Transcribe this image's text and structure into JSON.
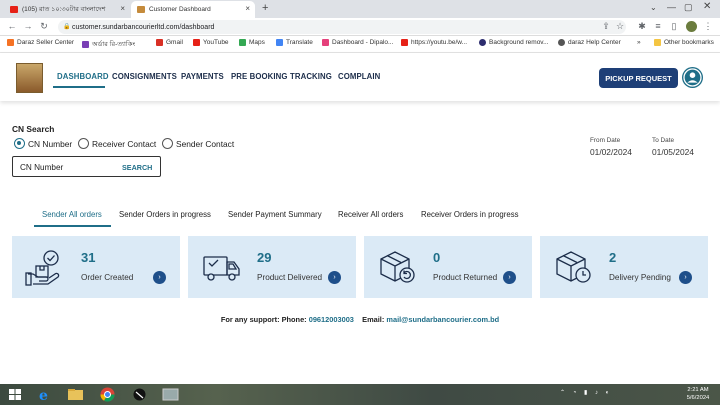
{
  "browser": {
    "tabs": [
      {
        "label": "(105) রাত ১০:৩০টার বাংলাদেশ",
        "active": false
      },
      {
        "label": "Customer Dashboard",
        "active": true
      }
    ],
    "url": "customer.sundarbancourierltd.com/dashboard",
    "bookmarks": [
      "Daraz Seller Center",
      "অর্ডার রি-ত্যাকিং",
      "Gmail",
      "YouTube",
      "Maps",
      "Translate",
      "Dashboard - Dipalo...",
      "https://youtu.be/w...",
      "Background remov...",
      "daraz Help Center",
      "Other bookmarks"
    ]
  },
  "nav": {
    "items": [
      "DASHBOARD",
      "CONSIGNMENTS",
      "PAYMENTS",
      "PRE BOOKING",
      "TRACKING",
      "COMPLAIN"
    ],
    "active": 0,
    "pickup_label": "PICKUP REQUEST"
  },
  "search": {
    "title": "CN Search",
    "options": [
      "CN Number",
      "Receiver Contact",
      "Sender Contact"
    ],
    "selected": 0,
    "input_value": "CN Number",
    "button_label": "SEARCH"
  },
  "dates": {
    "from_label": "From Date",
    "from_value": "01/02/2024",
    "to_label": "To Date",
    "to_value": "01/05/2024"
  },
  "order_tabs": [
    "Sender All orders",
    "Sender Orders in progress",
    "Sender Payment Summary",
    "Receiver All orders",
    "Receiver Orders in progress"
  ],
  "cards": [
    {
      "count": "31",
      "label": "Order Created",
      "icon": "order-created-icon"
    },
    {
      "count": "29",
      "label": "Product Delivered",
      "icon": "delivery-truck-icon"
    },
    {
      "count": "0",
      "label": "Product Returned",
      "icon": "returned-box-icon"
    },
    {
      "count": "2",
      "label": "Delivery Pending",
      "icon": "pending-box-icon"
    }
  ],
  "support": {
    "phone_label": "For any support: Phone:",
    "phone": "09612003003",
    "email_label": "Email:",
    "email": "mail@sundarbancourier.com.bd"
  },
  "taskbar": {
    "time": "2:21 AM",
    "date": "5/6/2024"
  },
  "colors": {
    "accent": "#1f6e88",
    "primary_button": "#1e3f77",
    "card_bg": "#dbeaf6"
  }
}
